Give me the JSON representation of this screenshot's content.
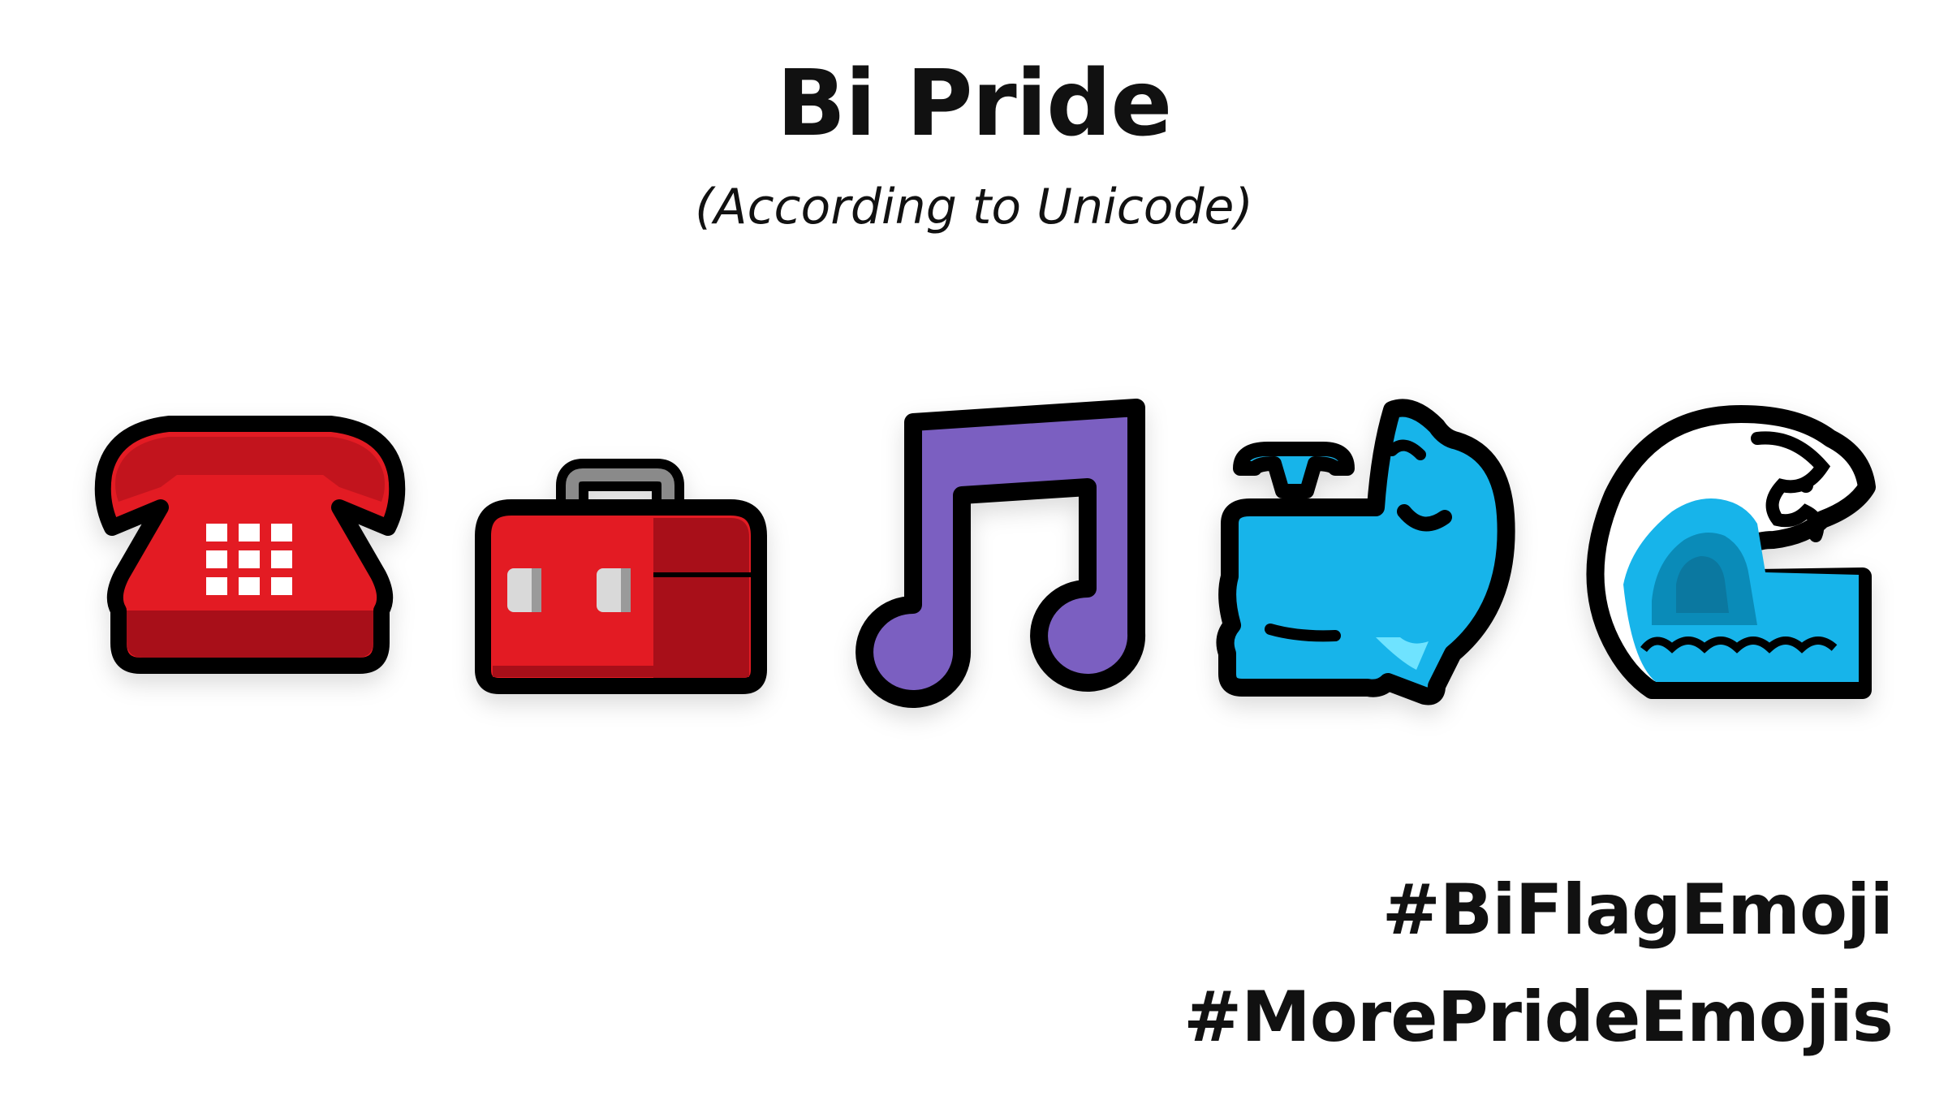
{
  "header": {
    "title": "Bi Pride",
    "subtitle": "(According to Unicode)"
  },
  "emojis": [
    {
      "icon": "telephone-icon",
      "color": "#e31b23"
    },
    {
      "icon": "toolbox-icon",
      "color": "#e31b23"
    },
    {
      "icon": "musical-notes-icon",
      "color": "#7b5fc1"
    },
    {
      "icon": "spouting-whale-icon",
      "color": "#17b4ea"
    },
    {
      "icon": "water-wave-icon",
      "color": "#17b4ea"
    }
  ],
  "hashtags": [
    "#BiFlagEmoji",
    "#MorePrideEmojis"
  ],
  "colors": {
    "background": "#ffffff",
    "text": "#111111",
    "red": "#e31b23",
    "purple": "#7b5fc1",
    "blue": "#17b4ea",
    "outline": "#000000"
  }
}
